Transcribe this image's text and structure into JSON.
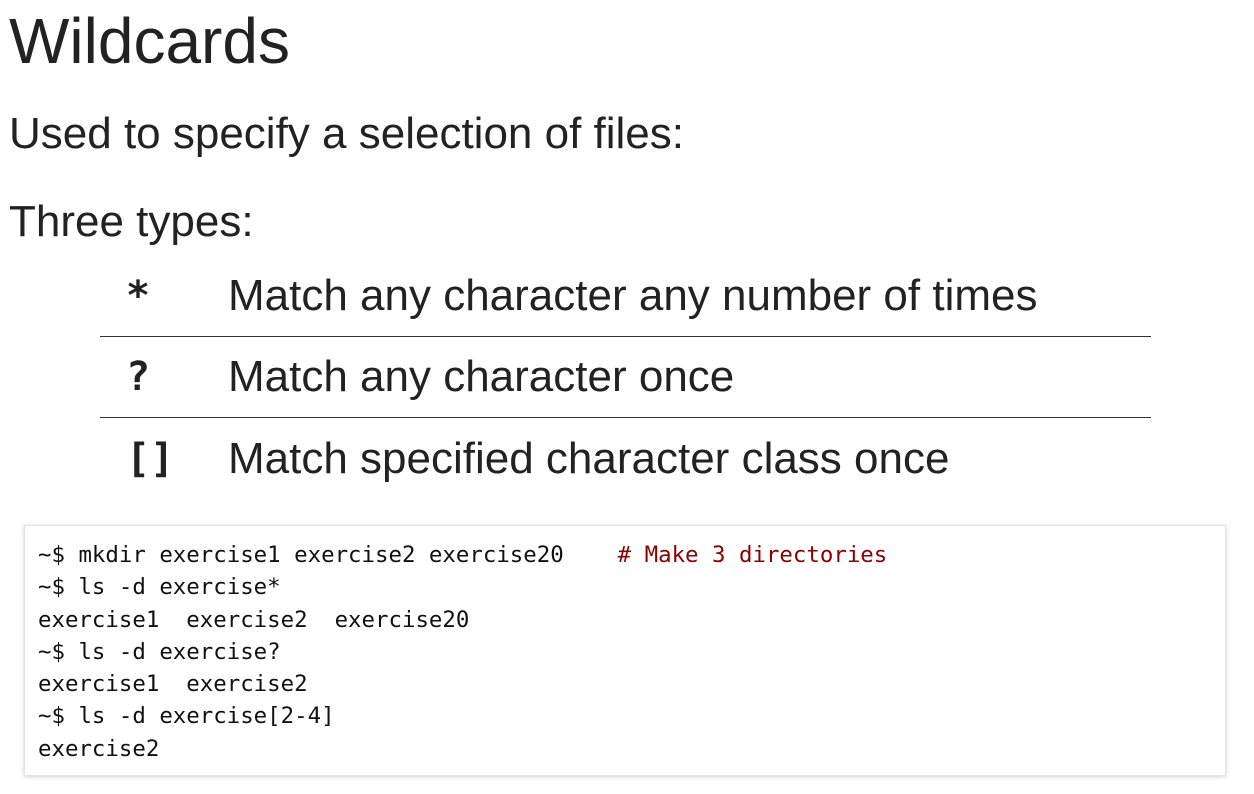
{
  "title": "Wildcards",
  "intro": "Used to specify a selection of files:",
  "types_heading": "Three types:",
  "wildcards": [
    {
      "symbol": "*",
      "description": "Match any character any number of times"
    },
    {
      "symbol": "?",
      "description": "Match any character once"
    },
    {
      "symbol": "[]",
      "description": "Match specified character class once"
    }
  ],
  "code": {
    "lines": [
      {
        "text": "~$ mkdir exercise1 exercise2 exercise20    ",
        "comment": "# Make 3 directories"
      },
      {
        "text": "~$ ls -d exercise*",
        "comment": ""
      },
      {
        "text": "exercise1  exercise2  exercise20",
        "comment": ""
      },
      {
        "text": "~$ ls -d exercise?",
        "comment": ""
      },
      {
        "text": "exercise1  exercise2",
        "comment": ""
      },
      {
        "text": "~$ ls -d exercise[2-4]",
        "comment": ""
      },
      {
        "text": "exercise2",
        "comment": ""
      }
    ],
    "colors": {
      "comment": "#8b0000",
      "text": "#111111"
    }
  }
}
